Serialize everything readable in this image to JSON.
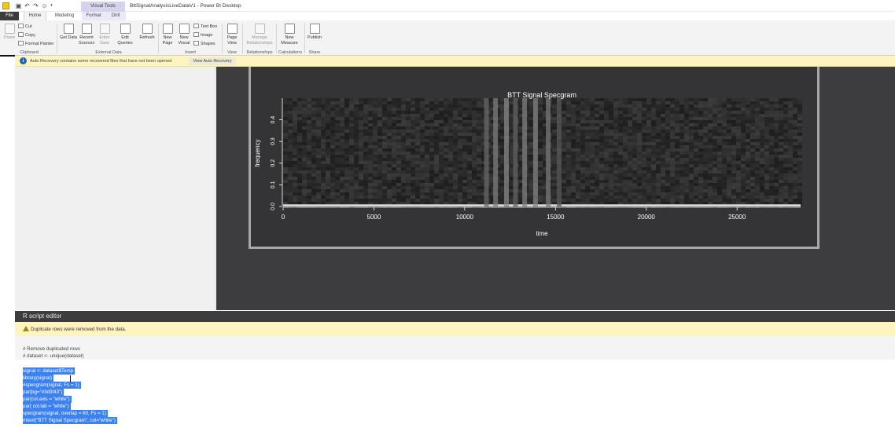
{
  "window": {
    "title": "BttSignalAnalysisLiveDataV1 - Power BI Desktop",
    "context_tab": "Visual Tools"
  },
  "quick_access": {
    "icons": [
      "save-icon",
      "undo-icon",
      "redo-icon",
      "smiley-icon",
      "dropdown-icon"
    ]
  },
  "tabs": [
    {
      "label": "File"
    },
    {
      "label": "Home",
      "active": true
    },
    {
      "label": "Modeling"
    },
    {
      "label": "Format"
    },
    {
      "label": "Drill"
    }
  ],
  "ribbon": {
    "clipboard": {
      "paste": "Paste",
      "cut": "Cut",
      "copy": "Copy",
      "format_painter": "Format Painter",
      "group": "Clipboard"
    },
    "external_data": {
      "get_data": "Get Data",
      "recent_sources": "Recent Sources",
      "enter_data": "Enter Data",
      "edit_queries": "Edit Queries",
      "refresh": "Refresh",
      "group": "External Data"
    },
    "insert": {
      "new_page": "New Page",
      "new_visual": "New Visual",
      "text_box": "Text Box",
      "image": "Image",
      "shapes": "Shapes",
      "group": "Insert"
    },
    "view": {
      "page_view": "Page View",
      "group": "View"
    },
    "relationships": {
      "manage": "Manage Relationships",
      "group": "Relationships"
    },
    "calculations": {
      "new_measure": "New Measure",
      "group": "Calculations"
    },
    "share": {
      "publish": "Publish",
      "group": "Share"
    }
  },
  "info_bar": {
    "text": "Auto Recovery contains some recovered files that have not been opened",
    "button": "View Auto Recovery"
  },
  "colors": {
    "canvas": "#3d3d3f",
    "selection": "#3b82f0",
    "info_bar": "#fdf4bf",
    "file_tab": "#3c3c3c"
  },
  "chart_data": {
    "type": "heatmap",
    "title": "BTT Signal Specgram",
    "xlabel": "time",
    "ylabel": "frequency",
    "xlim": [
      0,
      28500
    ],
    "ylim": [
      0,
      0.5
    ],
    "x_ticks": [
      0,
      5000,
      10000,
      15000,
      20000,
      25000
    ],
    "y_ticks": [
      0.0,
      0.1,
      0.2,
      0.3,
      0.4
    ],
    "bright_bands": [
      {
        "x": 11200,
        "level": 0.22
      },
      {
        "x": 11700,
        "level": 0.33
      },
      {
        "x": 12300,
        "level": 0.38
      },
      {
        "x": 12800,
        "level": 0.2
      },
      {
        "x": 13300,
        "level": 0.34
      },
      {
        "x": 13900,
        "level": 0.36
      },
      {
        "x": 14600,
        "level": 0.3
      },
      {
        "x": 15200,
        "level": 0.14
      }
    ]
  },
  "r_editor": {
    "title": "R script editor",
    "warning": "Duplicate rows were removed from the data.",
    "comments": [
      "# Remove duplicated rows",
      "# dataset <- unique(dataset)"
    ],
    "code": [
      "signal <- dataset$Temp",
      "library(signal)",
      "#specgram(signal, Fs = 1)",
      "par(bg=\"#3d3f43\")",
      "par(col.axis = \"white\")",
      "par( col.lab = \"white\")",
      "specgram(signal, overlap = 60, Fs = 1)",
      "mtext(\"BTT Signal Specgram\", col=\"white\")"
    ]
  }
}
